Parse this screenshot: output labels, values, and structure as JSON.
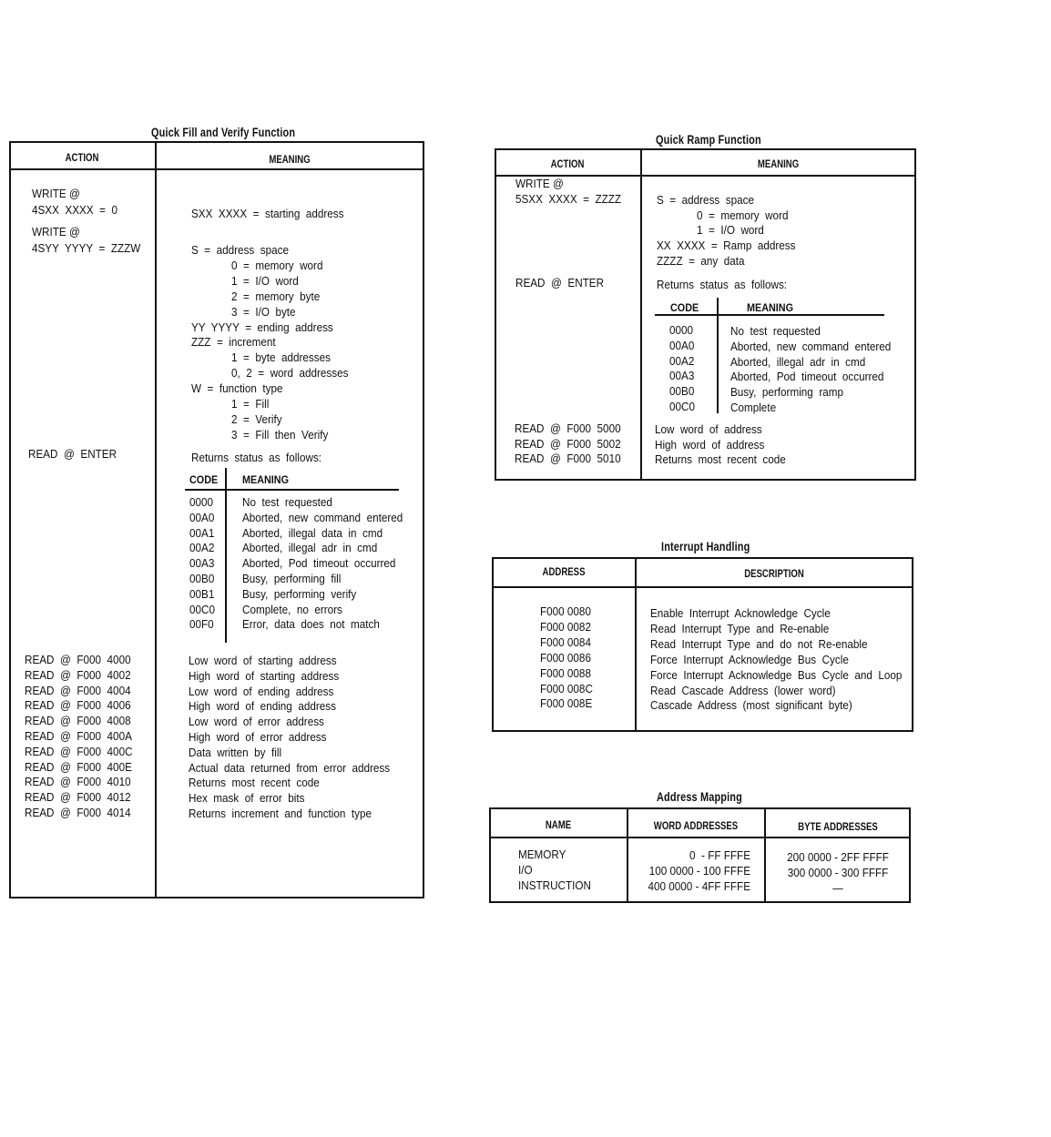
{
  "quick_fill": {
    "title": "Quick Fill and Verify Function",
    "headers": {
      "action": "ACTION",
      "meaning": "MEANING"
    },
    "write_actions": [
      "WRITE @",
      "4SXX  XXXX  =  0",
      "WRITE @",
      "4SYY  YYYY  =  ZZZW"
    ],
    "start_def": "SXX  XXXX  =  starting  address",
    "definitions": [
      {
        "term": "S  =  address  space",
        "options": [
          "0  =  memory  word",
          "1  =  I/O  word",
          "2  =  memory  byte",
          "3  =  I/O  byte"
        ]
      },
      {
        "term": "YY  YYYY  =  ending  address",
        "options": []
      },
      {
        "term": "ZZZ  =  increment",
        "options": [
          "1  =  byte  addresses",
          "0,  2  =  word  addresses"
        ]
      },
      {
        "term": "W  =  function  type",
        "options": [
          "1  =  Fill",
          "2  =  Verify",
          "3  =  Fill  then  Verify"
        ]
      }
    ],
    "read_enter": "READ  @  ENTER",
    "returns": "Returns  status  as  follows:",
    "status_headers": {
      "code": "CODE",
      "meaning": "MEANING"
    },
    "status_codes": [
      {
        "code": "0000",
        "meaning": "No  test  requested"
      },
      {
        "code": "00A0",
        "meaning": "Aborted,  new  command  entered"
      },
      {
        "code": "00A1",
        "meaning": "Aborted,  illegal  data  in  cmd"
      },
      {
        "code": "00A2",
        "meaning": "Aborted,  illegal  adr  in  cmd"
      },
      {
        "code": "00A3",
        "meaning": "Aborted,  Pod  timeout  occurred"
      },
      {
        "code": "00B0",
        "meaning": "Busy,  performing  fill"
      },
      {
        "code": "00B1",
        "meaning": "Busy,  performing  verify"
      },
      {
        "code": "00C0",
        "meaning": "Complete,  no  errors"
      },
      {
        "code": "00F0",
        "meaning": "Error,  data  does  not  match"
      }
    ],
    "reads": [
      {
        "action": "READ  @  F000  4000",
        "meaning": "Low  word  of  starting  address"
      },
      {
        "action": "READ  @  F000  4002",
        "meaning": "High  word  of  starting  address"
      },
      {
        "action": "READ  @  F000  4004",
        "meaning": "Low  word  of  ending  address"
      },
      {
        "action": "READ  @  F000  4006",
        "meaning": "High  word  of  ending  address"
      },
      {
        "action": "READ  @  F000  4008",
        "meaning": "Low  word  of  error  address"
      },
      {
        "action": "READ  @  F000  400A",
        "meaning": "High  word  of  error  address"
      },
      {
        "action": "READ  @  F000  400C",
        "meaning": "Data  written  by  fill"
      },
      {
        "action": "READ  @  F000  400E",
        "meaning": "Actual  data  returned  from  error  address"
      },
      {
        "action": "READ  @  F000  4010",
        "meaning": "Returns  most  recent  code"
      },
      {
        "action": "READ  @  F000  4012",
        "meaning": "Hex  mask  of  error  bits"
      },
      {
        "action": "READ  @  F000  4014",
        "meaning": "Returns  increment  and  function  type"
      }
    ]
  },
  "quick_ramp": {
    "title": "Quick Ramp Function",
    "headers": {
      "action": "ACTION",
      "meaning": "MEANING"
    },
    "write_actions": [
      "WRITE @",
      "5SXX  XXXX  =  ZZZZ"
    ],
    "definitions": [
      {
        "term": "S  =  address  space",
        "options": [
          "0  =  memory  word",
          "1  =  I/O  word"
        ]
      },
      {
        "term": "XX  XXXX  =  Ramp  address",
        "options": []
      },
      {
        "term": "ZZZZ  =  any  data",
        "options": []
      }
    ],
    "read_enter": "READ  @  ENTER",
    "returns": "Returns  status  as  follows:",
    "status_headers": {
      "code": "CODE",
      "meaning": "MEANING"
    },
    "status_codes": [
      {
        "code": "0000",
        "meaning": "No  test  requested"
      },
      {
        "code": "00A0",
        "meaning": "Aborted,  new  command  entered"
      },
      {
        "code": "00A2",
        "meaning": "Aborted,  illegal  adr  in  cmd"
      },
      {
        "code": "00A3",
        "meaning": "Aborted,  Pod  timeout  occurred"
      },
      {
        "code": "00B0",
        "meaning": "Busy,  performing  ramp"
      },
      {
        "code": "00C0",
        "meaning": "Complete"
      }
    ],
    "reads": [
      {
        "action": "READ  @  F000  5000",
        "meaning": "Low  word  of  address"
      },
      {
        "action": "READ  @  F000  5002",
        "meaning": "High  word  of  address"
      },
      {
        "action": "READ  @  F000  5010",
        "meaning": "Returns  most  recent  code"
      }
    ]
  },
  "interrupt": {
    "title": "Interrupt Handling",
    "headers": {
      "address": "ADDRESS",
      "description": "DESCRIPTION"
    },
    "rows": [
      {
        "address": "F000 0080",
        "description": "Enable  Interrupt  Acknowledge  Cycle"
      },
      {
        "address": "F000 0082",
        "description": "Read  Interrupt  Type  and  Re-enable"
      },
      {
        "address": "F000 0084",
        "description": "Read  Interrupt  Type  and  do  not  Re-enable"
      },
      {
        "address": "F000 0086",
        "description": "Force  Interrupt  Acknowledge  Bus  Cycle"
      },
      {
        "address": "F000 0088",
        "description": "Force  Interrupt  Acknowledge  Bus  Cycle  and  Loop"
      },
      {
        "address": "F000 008C",
        "description": "Read  Cascade  Address  (lower  word)"
      },
      {
        "address": "F000 008E",
        "description": "Cascade  Address  (most  significant  byte)"
      }
    ]
  },
  "address_mapping": {
    "title": "Address Mapping",
    "headers": {
      "name": "NAME",
      "word": "WORD ADDRESSES",
      "byte": "BYTE ADDRESSES"
    },
    "rows": [
      {
        "name": "MEMORY",
        "word": "0  - FF FFFE",
        "byte": "200 0000 - 2FF FFFF"
      },
      {
        "name": "I/O",
        "word": "100 0000 - 100 FFFE",
        "byte": "300 0000 - 300 FFFF"
      },
      {
        "name": "INSTRUCTION",
        "word": "400 0000 - 4FF FFFE",
        "byte": "—"
      }
    ]
  }
}
